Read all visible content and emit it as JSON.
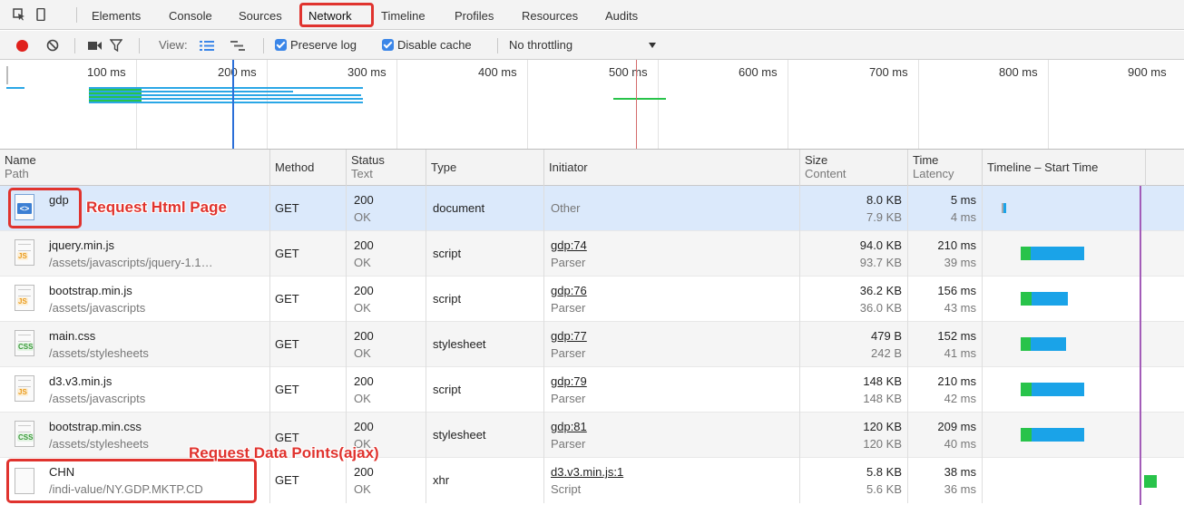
{
  "tabs": [
    "Elements",
    "Console",
    "Sources",
    "Network",
    "Timeline",
    "Profiles",
    "Resources",
    "Audits"
  ],
  "active_tab": "Network",
  "toolbar": {
    "view_label": "View:",
    "preserve_log": "Preserve log",
    "disable_cache": "Disable cache",
    "throttling": "No throttling"
  },
  "overview": {
    "ticks": [
      "100 ms",
      "200 ms",
      "300 ms",
      "400 ms",
      "500 ms",
      "600 ms",
      "700 ms",
      "800 ms",
      "900 ms"
    ],
    "colors": {
      "dom_content_loaded": "#2b6fd8",
      "load": "#d46b6b"
    }
  },
  "columns": {
    "name": "Name",
    "path": "Path",
    "method": "Method",
    "status": "Status",
    "text": "Text",
    "type": "Type",
    "initiator": "Initiator",
    "size": "Size",
    "content": "Content",
    "time": "Time",
    "latency": "Latency",
    "timeline": "Timeline – Start Time"
  },
  "requests": [
    {
      "name": "gdp",
      "path": "",
      "method": "GET",
      "status": "200",
      "text": "OK",
      "type": "document",
      "initiator": "Other",
      "initiator_sub": "",
      "size": "8.0 KB",
      "content": "7.9 KB",
      "time": "5 ms",
      "latency": "4 ms",
      "icon": "document-icon"
    },
    {
      "name": "jquery.min.js",
      "path": "/assets/javascripts/jquery-1.1…",
      "method": "GET",
      "status": "200",
      "text": "OK",
      "type": "script",
      "initiator": "gdp:74",
      "initiator_sub": "Parser",
      "size": "94.0 KB",
      "content": "93.7 KB",
      "time": "210 ms",
      "latency": "39 ms",
      "icon": "js-file-icon"
    },
    {
      "name": "bootstrap.min.js",
      "path": "/assets/javascripts",
      "method": "GET",
      "status": "200",
      "text": "OK",
      "type": "script",
      "initiator": "gdp:76",
      "initiator_sub": "Parser",
      "size": "36.2 KB",
      "content": "36.0 KB",
      "time": "156 ms",
      "latency": "43 ms",
      "icon": "js-file-icon"
    },
    {
      "name": "main.css",
      "path": "/assets/stylesheets",
      "method": "GET",
      "status": "200",
      "text": "OK",
      "type": "stylesheet",
      "initiator": "gdp:77",
      "initiator_sub": "Parser",
      "size": "479 B",
      "content": "242 B",
      "time": "152 ms",
      "latency": "41 ms",
      "icon": "css-file-icon"
    },
    {
      "name": "d3.v3.min.js",
      "path": "/assets/javascripts",
      "method": "GET",
      "status": "200",
      "text": "OK",
      "type": "script",
      "initiator": "gdp:79",
      "initiator_sub": "Parser",
      "size": "148 KB",
      "content": "148 KB",
      "time": "210 ms",
      "latency": "42 ms",
      "icon": "js-file-icon"
    },
    {
      "name": "bootstrap.min.css",
      "path": "/assets/stylesheets",
      "method": "GET",
      "status": "200",
      "text": "OK",
      "type": "stylesheet",
      "initiator": "gdp:81",
      "initiator_sub": "Parser",
      "size": "120 KB",
      "content": "120 KB",
      "time": "209 ms",
      "latency": "40 ms",
      "icon": "css-file-icon"
    },
    {
      "name": "CHN",
      "path": "/indi-value/NY.GDP.MKTP.CD",
      "method": "GET",
      "status": "200",
      "text": "OK",
      "type": "xhr",
      "initiator": "d3.v3.min.js:1",
      "initiator_sub": "Script",
      "size": "5.8 KB",
      "content": "5.6 KB",
      "time": "38 ms",
      "latency": "36 ms",
      "icon": "blank-file-icon"
    }
  ],
  "annotations": {
    "html_page": "Request Html Page",
    "data_points": "Request Data Points(ajax)",
    "color": "#e0332e"
  }
}
